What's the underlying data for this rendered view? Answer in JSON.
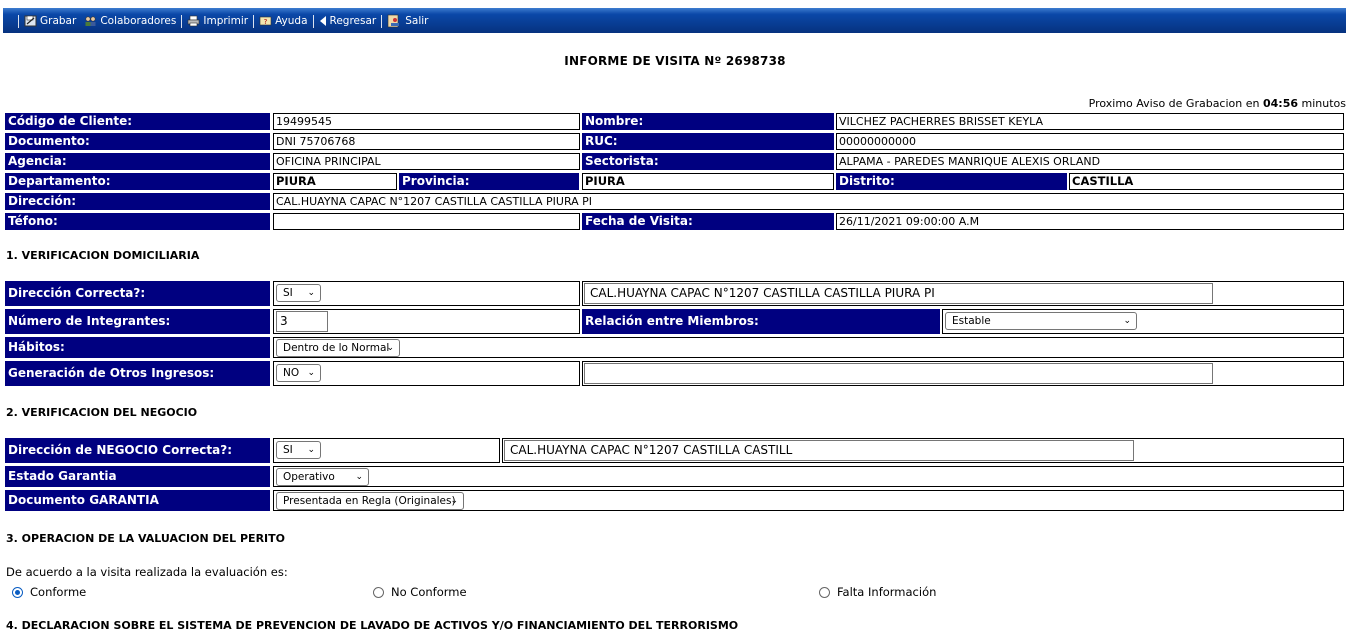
{
  "toolbar": {
    "grabar": "Grabar",
    "colaboradores": "Colaboradores",
    "imprimir": "Imprimir",
    "ayuda": "Ayuda",
    "regresar": "Regresar",
    "salir": "Salir"
  },
  "title": "INFORME DE VISITA Nº 2698738",
  "aviso": {
    "prefix": "Proximo Aviso de Grabacion en",
    "time": "04:56",
    "suffix": "minutos"
  },
  "cliente": {
    "codigo_label": "Código de Cliente:",
    "codigo": "19499545",
    "nombre_label": "Nombre:",
    "nombre": "VILCHEZ PACHERRES BRISSET KEYLA",
    "documento_label": "Documento:",
    "documento": "DNI 75706768",
    "ruc_label": "RUC:",
    "ruc": "00000000000",
    "agencia_label": "Agencia:",
    "agencia": "OFICINA PRINCIPAL",
    "sectorista_label": "Sectorista:",
    "sectorista": "ALPAMA - PAREDES MANRIQUE ALEXIS ORLAND",
    "departamento_label": "Departamento:",
    "departamento": "PIURA",
    "provincia_label": "Provincia:",
    "provincia": "PIURA",
    "distrito_label": "Distrito:",
    "distrito": "CASTILLA",
    "direccion_label": "Dirección:",
    "direccion": "CAL.HUAYNA CAPAC N°1207 CASTILLA CASTILLA PIURA PI",
    "telefono_label": "Téfono:",
    "telefono": "",
    "fecha_label": "Fecha de Visita:",
    "fecha": "26/11/2021 09:00:00 A.M"
  },
  "sec1": {
    "title": "1. VERIFICACION DOMICILIARIA",
    "dir_label": "Dirección Correcta?:",
    "dir_select": "SI",
    "dir_value": "CAL.HUAYNA CAPAC N°1207 CASTILLA CASTILLA PIURA PI",
    "integrantes_label": "Número de Integrantes:",
    "integrantes_value": "3",
    "relacion_label": "Relación entre Miembros:",
    "relacion_select": "Estable",
    "habitos_label": "Hábitos:",
    "habitos_select": "Dentro de lo Normal",
    "ingresos_label": "Generación de Otros Ingresos:",
    "ingresos_select": "NO",
    "ingresos_value": ""
  },
  "sec2": {
    "title": "2. VERIFICACION DEL NEGOCIO",
    "dir_label": "Dirección de NEGOCIO Correcta?:",
    "dir_select": "SI",
    "dir_value": "CAL.HUAYNA CAPAC N°1207 CASTILLA CASTILL",
    "estado_label": "Estado Garantia",
    "estado_select": "Operativo",
    "documento_label": "Documento GARANTIA",
    "documento_select": "Presentada en Regla (Originales)"
  },
  "sec3": {
    "title": "3. OPERACION DE LA VALUACION DEL PERITO",
    "question": "De acuerdo a la visita realizada la evaluación es:",
    "options": [
      "Conforme",
      "No Conforme",
      "Falta Información"
    ],
    "selected": "Conforme"
  },
  "sec4": {
    "title": "4. DECLARACION SOBRE EL SISTEMA DE PREVENCION DE LAVADO DE ACTIVOS Y/O FINANCIAMIENTO DEL TERRORISMO"
  }
}
